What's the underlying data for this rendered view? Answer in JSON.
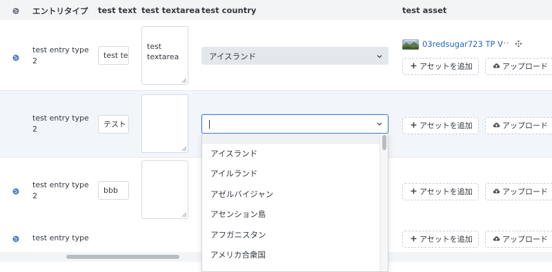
{
  "header": {
    "type_col": "エントリタイプ",
    "text_col": "test text",
    "textarea_col": "test textarea",
    "country_col": "test country",
    "asset_col": "test asset"
  },
  "rows": [
    {
      "type": "test entry type 2",
      "text": "test te",
      "textarea": "test\ntextarea",
      "country": "アイスランド",
      "asset_name": "03redsugar723 TP V",
      "asset_menu": "···"
    },
    {
      "type": "test entry type 2",
      "text": "テスト",
      "textarea": "",
      "country": ""
    },
    {
      "type": "test entry type 2",
      "text": "bbb",
      "textarea": ""
    },
    {
      "type": "test entry type"
    }
  ],
  "buttons": {
    "add_asset": "アセットを追加",
    "upload": "アップロード"
  },
  "dropdown": {
    "options": [
      "アイスランド",
      "アイルランド",
      "アゼルバイジャン",
      "アセンション島",
      "アフガニスタン",
      "アメリカ合衆国"
    ]
  },
  "colors": {
    "link": "#2563c8",
    "focus": "#3d7ad6",
    "globe": "#4a78c2",
    "header_bg": "#f3f4f6",
    "row_highlight": "#f2f5fa"
  },
  "icons": {
    "globe": "globe-icon",
    "plus": "plus-icon",
    "upload": "cloud-upload-icon",
    "chevron": "chevron-down-icon",
    "move": "move-icon",
    "resize": "resize-grip-icon"
  }
}
